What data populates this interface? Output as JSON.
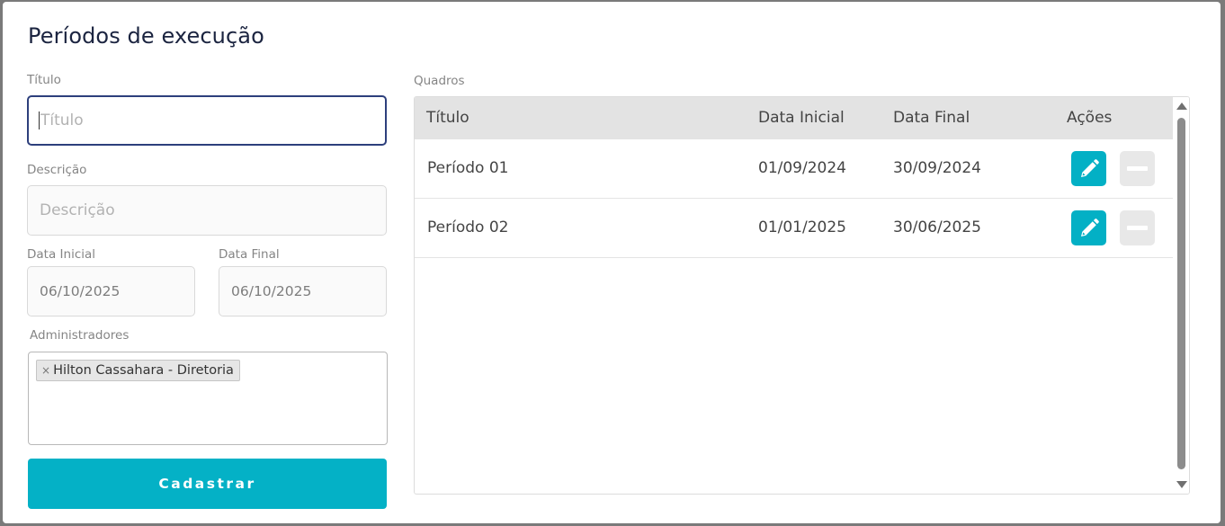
{
  "modal": {
    "title": "Períodos de execução"
  },
  "form": {
    "titulo": {
      "label": "Título",
      "placeholder": "Título",
      "value": ""
    },
    "descricao": {
      "label": "Descrição",
      "placeholder": "Descrição",
      "value": ""
    },
    "data_inicial": {
      "label": "Data Inicial",
      "value": "06/10/2025"
    },
    "data_final": {
      "label": "Data Final",
      "value": "06/10/2025"
    },
    "administradores": {
      "label": "Administradores",
      "tags": [
        {
          "remove": "×",
          "text": "Hilton Cassahara - Diretoria"
        }
      ]
    },
    "submit_label": "Cadastrar"
  },
  "quadros": {
    "label": "Quadros",
    "columns": [
      "Título",
      "Data Inicial",
      "Data Final",
      "Ações"
    ],
    "rows": [
      {
        "titulo": "Período 01",
        "data_inicial": "01/09/2024",
        "data_final": "30/09/2024"
      },
      {
        "titulo": "Período 02",
        "data_inicial": "01/01/2025",
        "data_final": "30/06/2025"
      }
    ]
  },
  "icons": {
    "edit": "pencil-icon",
    "remove": "minus-icon"
  },
  "colors": {
    "accent": "#04b1c6",
    "title": "#1b2440",
    "focus_border": "#2d3f7c",
    "remove_button": "#e8e8e8"
  }
}
